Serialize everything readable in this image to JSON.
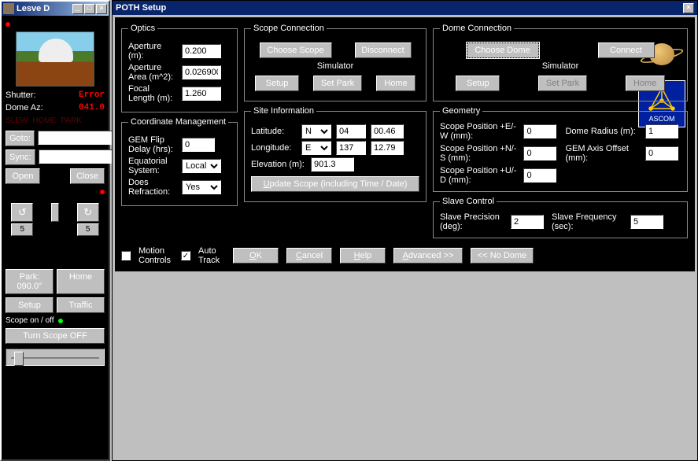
{
  "left": {
    "title": "Lesve D",
    "shutter_label": "Shutter:",
    "shutter_value": "Error",
    "dome_az_label": "Dome Az:",
    "dome_az_value": "041.0",
    "slew": "SLEW",
    "home": "HOME",
    "park": "PARK",
    "goto": "Goto:",
    "sync": "Sync:",
    "open": "Open",
    "close": "Close",
    "spin_left": "5",
    "spin_right": "5",
    "park_btn": "Park: 090.0°",
    "home_btn": "Home",
    "setup_btn": "Setup",
    "traffic_btn": "Traffic",
    "scope_label": "Scope on / off",
    "turn_off": "Turn Scope OFF"
  },
  "right": {
    "title": "POTH Setup",
    "optics": {
      "legend": "Optics",
      "aperture_l": "Aperture (m):",
      "aperture_v": "0.200",
      "area_l": "Aperture Area (m^2):",
      "area_v": "0.026900",
      "focal_l": "Focal Length (m):",
      "focal_v": "1.260"
    },
    "coord": {
      "legend": "Coordinate Management",
      "gem_l": "GEM Flip Delay (hrs):",
      "gem_v": "0",
      "eq_l": "Equatorial System:",
      "eq_v": "Local",
      "ref_l": "Does Refraction:",
      "ref_v": "Yes"
    },
    "scopeconn": {
      "legend": "Scope Connection",
      "choose": "Choose Scope",
      "disconnect": "Disconnect",
      "sim": "Simulator",
      "setup": "Setup",
      "setpark": "Set Park",
      "home": "Home"
    },
    "site": {
      "legend": "Site Information",
      "lat_l": "Latitude:",
      "lat_dir": "N",
      "lat_deg": "04",
      "lat_min": "00.46",
      "lon_l": "Longitude:",
      "lon_dir": "E",
      "lon_deg": "137",
      "lon_min": "12.79",
      "elev_l": "Elevation (m):",
      "elev_v": "901.3",
      "update": "Update Scope (including Time / Date)"
    },
    "domeconn": {
      "legend": "Dome Connection",
      "choose": "Choose Dome",
      "connect": "Connect",
      "sim": "Simulator",
      "setup": "Setup",
      "setpark": "Set Park",
      "home": "Home"
    },
    "geom": {
      "legend": "Geometry",
      "ew_l": "Scope Position +E/-W (mm):",
      "ew_v": "0",
      "ns_l": "Scope Position +N/-S (mm):",
      "ns_v": "0",
      "ud_l": "Scope Position +U/-D (mm):",
      "ud_v": "0",
      "rad_l": "Dome Radius (m):",
      "rad_v": "1",
      "axis_l": "GEM Axis Offset (mm):",
      "axis_v": "0"
    },
    "slave": {
      "legend": "Slave Control",
      "prec_l": "Slave Precision (deg):",
      "prec_v": "2",
      "freq_l": "Slave Frequency (sec):",
      "freq_v": "5"
    },
    "bottom": {
      "motion": "Motion Controls",
      "auto": "Auto Track",
      "ok": "OK",
      "cancel": "Cancel",
      "help": "Help",
      "adv": "Advanced >>",
      "nodome": "<< No Dome"
    },
    "ascom": "ASCOM"
  }
}
